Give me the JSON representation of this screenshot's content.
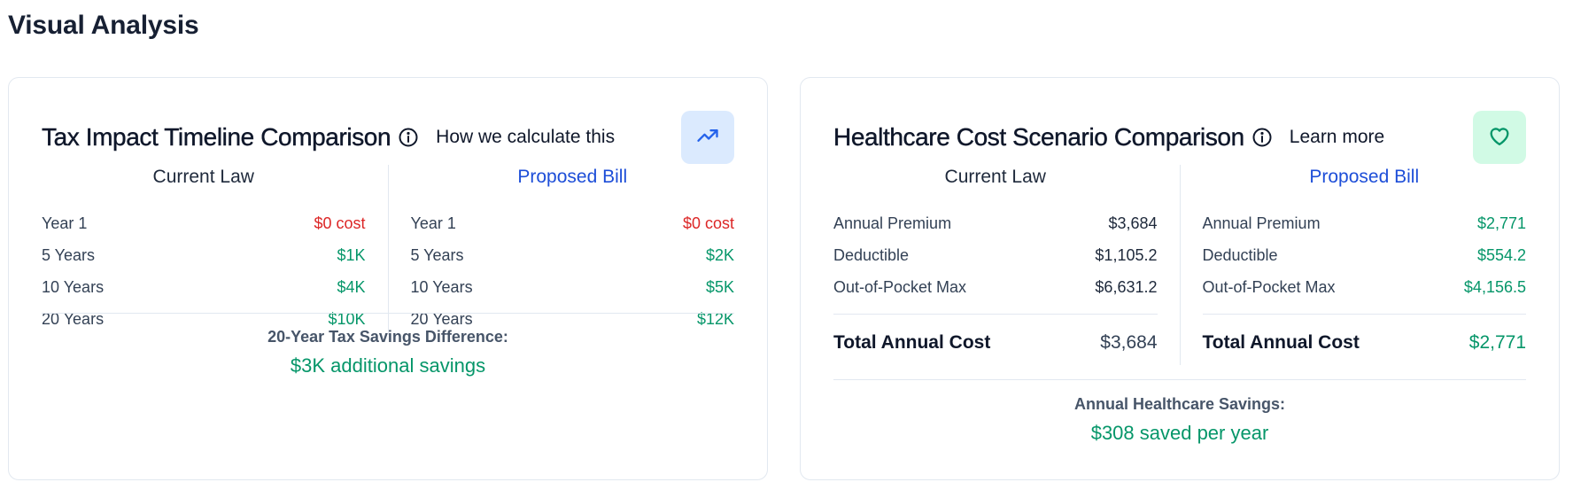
{
  "page": {
    "title": "Visual Analysis"
  },
  "colors": {
    "accent_blue": "#1d4ed8",
    "positive_green": "#059669",
    "negative_red": "#dc2626",
    "blue_badge_bg": "#dbeafe",
    "green_badge_bg": "#d1fae5"
  },
  "tax_card": {
    "title": "Tax Impact Timeline Comparison",
    "info_icon": "info-circle-icon",
    "link_label": "How we calculate this",
    "badge_icon": "trending-up-icon",
    "current": {
      "heading": "Current Law",
      "rows": [
        {
          "label": "Year 1",
          "value": "$0 cost"
        },
        {
          "label": "5 Years",
          "value": "$1K"
        },
        {
          "label": "10 Years",
          "value": "$4K"
        },
        {
          "label": "20 Years",
          "value": "$10K"
        }
      ]
    },
    "proposed": {
      "heading": "Proposed Bill",
      "rows": [
        {
          "label": "Year 1",
          "value": "$0 cost"
        },
        {
          "label": "5 Years",
          "value": "$2K"
        },
        {
          "label": "10 Years",
          "value": "$5K"
        },
        {
          "label": "20 Years",
          "value": "$12K"
        }
      ]
    },
    "summary_label": "20-Year Tax Savings Difference:",
    "summary_value": "$3K additional savings"
  },
  "health_card": {
    "title": "Healthcare Cost Scenario Comparison",
    "info_icon": "info-circle-icon",
    "link_label": "Learn more",
    "badge_icon": "heart-icon",
    "current": {
      "heading": "Current Law",
      "rows": [
        {
          "label": "Annual Premium",
          "value": "$3,684"
        },
        {
          "label": "Deductible",
          "value": "$1,105.2"
        },
        {
          "label": "Out-of-Pocket Max",
          "value": "$6,631.2"
        }
      ],
      "total_label": "Total Annual Cost",
      "total_value": "$3,684"
    },
    "proposed": {
      "heading": "Proposed Bill",
      "rows": [
        {
          "label": "Annual Premium",
          "value": "$2,771"
        },
        {
          "label": "Deductible",
          "value": "$554.2"
        },
        {
          "label": "Out-of-Pocket Max",
          "value": "$4,156.5"
        }
      ],
      "total_label": "Total Annual Cost",
      "total_value": "$2,771"
    },
    "summary_label": "Annual Healthcare Savings:",
    "summary_value": "$308 saved per year"
  }
}
